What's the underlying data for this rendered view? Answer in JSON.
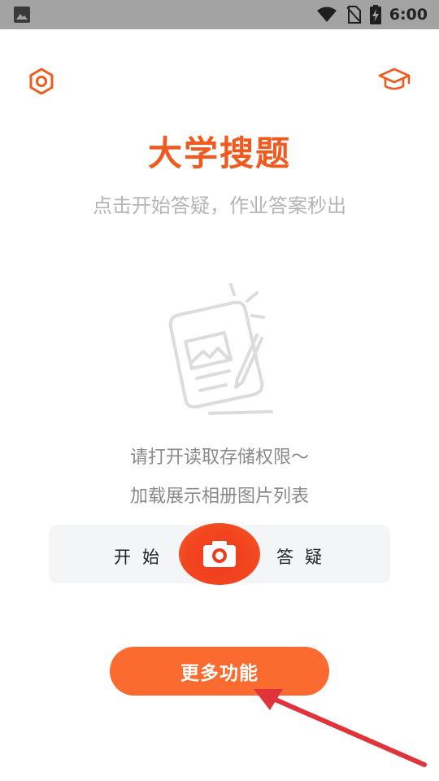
{
  "status_bar": {
    "time": "6:00",
    "icons": [
      "image-icon",
      "wifi-icon",
      "no-sim-icon",
      "battery-charging-icon"
    ]
  },
  "header": {
    "left_icon": "settings-hexagon-icon",
    "right_icon": "graduation-cap-icon"
  },
  "main": {
    "title": "大学搜题",
    "subtitle": "点击开始答疑，作业答案秒出",
    "illustration_icon": "photo-card-pencil-icon",
    "permission_line1": "请打开读取存储权限～",
    "permission_line2": "加载展示相册图片列表"
  },
  "answer_bar": {
    "left_label": "开始",
    "right_label": "答疑",
    "camera_icon": "camera-icon"
  },
  "more_button": {
    "label": "更多功能"
  },
  "colors": {
    "accent": "#f15a1f",
    "button": "#fb6a2e",
    "camera": "#ef3b20",
    "annotation_arrow": "#e0333a"
  }
}
